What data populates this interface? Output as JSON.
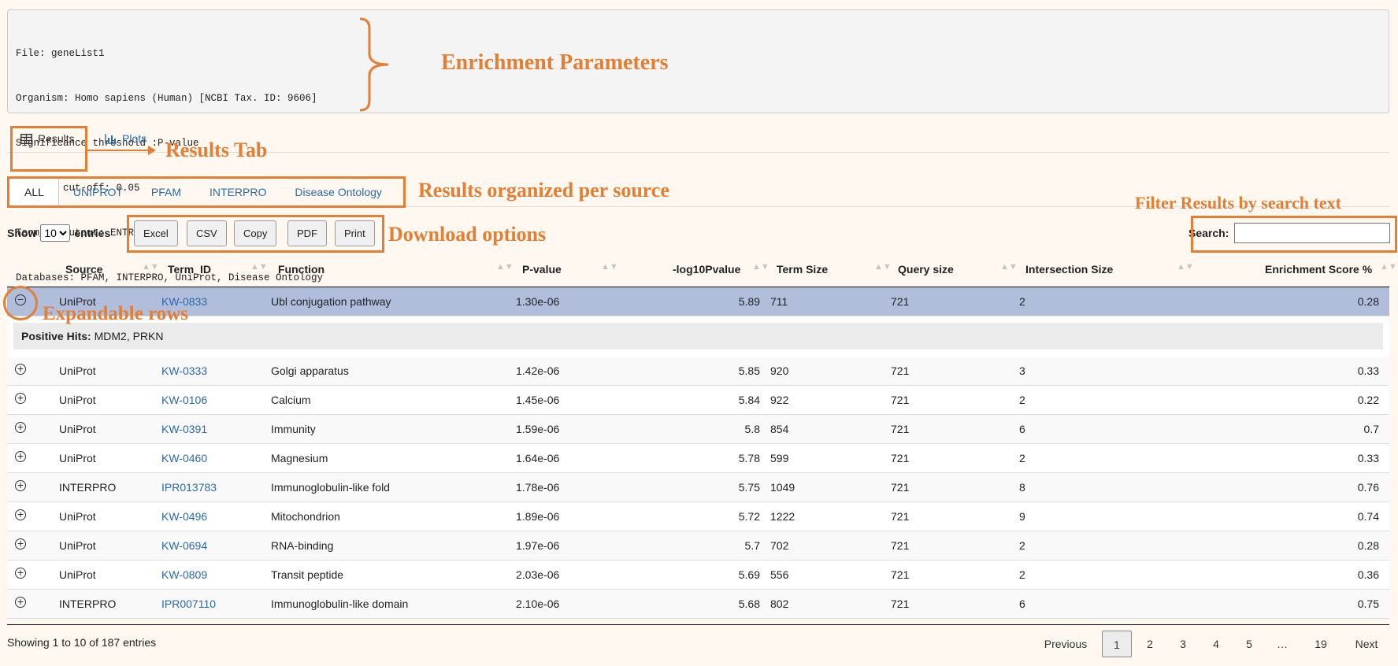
{
  "params": {
    "lines": [
      "File: geneList1",
      "Organism: Homo sapiens (Human) [NCBI Tax. ID: 9606]",
      "Significance threshold :P-value",
      "P-Value cut-off: 0.05",
      "Term_ID output: ENTREZGENE",
      "Databases: PFAM, INTERPRO, UniProt, Disease Ontology"
    ]
  },
  "annotations": {
    "enrichment": "Enrichment Parameters",
    "results_tab": "Results Tab",
    "per_source": "Results organized per source",
    "download": "Download options",
    "filter": "Filter  Results by search text",
    "expandable": "Expandable rows"
  },
  "tabs": {
    "results": "Results",
    "plots": "Plots"
  },
  "sources": [
    "ALL",
    "UNIPROT",
    "PFAM",
    "INTERPRO",
    "Disease Ontology"
  ],
  "controls": {
    "show": "Show",
    "entries_value": "10",
    "entries": "entries",
    "search_label": "Search:",
    "buttons": [
      "Excel",
      "CSV",
      "Copy",
      "PDF",
      "Print"
    ]
  },
  "columns": [
    "Source",
    "Term_ID",
    "Function",
    "P-value",
    "-log10Pvalue",
    "Term Size",
    "Query size",
    "Intersection Size",
    "Enrichment Score %"
  ],
  "rows": [
    {
      "source": "UniProt",
      "term_id": "KW-0833",
      "function": "Ubl conjugation pathway",
      "pvalue": "1.30e-06",
      "log10": "5.89",
      "term_size": "711",
      "query_size": "721",
      "intersection": "2",
      "score": "0.28"
    },
    {
      "source": "UniProt",
      "term_id": "KW-0333",
      "function": "Golgi apparatus",
      "pvalue": "1.42e-06",
      "log10": "5.85",
      "term_size": "920",
      "query_size": "721",
      "intersection": "3",
      "score": "0.33"
    },
    {
      "source": "UniProt",
      "term_id": "KW-0106",
      "function": "Calcium",
      "pvalue": "1.45e-06",
      "log10": "5.84",
      "term_size": "922",
      "query_size": "721",
      "intersection": "2",
      "score": "0.22"
    },
    {
      "source": "UniProt",
      "term_id": "KW-0391",
      "function": "Immunity",
      "pvalue": "1.59e-06",
      "log10": "5.8",
      "term_size": "854",
      "query_size": "721",
      "intersection": "6",
      "score": "0.7"
    },
    {
      "source": "UniProt",
      "term_id": "KW-0460",
      "function": "Magnesium",
      "pvalue": "1.64e-06",
      "log10": "5.78",
      "term_size": "599",
      "query_size": "721",
      "intersection": "2",
      "score": "0.33"
    },
    {
      "source": "INTERPRO",
      "term_id": "IPR013783",
      "function": "Immunoglobulin-like fold",
      "pvalue": "1.78e-06",
      "log10": "5.75",
      "term_size": "1049",
      "query_size": "721",
      "intersection": "8",
      "score": "0.76"
    },
    {
      "source": "UniProt",
      "term_id": "KW-0496",
      "function": "Mitochondrion",
      "pvalue": "1.89e-06",
      "log10": "5.72",
      "term_size": "1222",
      "query_size": "721",
      "intersection": "9",
      "score": "0.74"
    },
    {
      "source": "UniProt",
      "term_id": "KW-0694",
      "function": "RNA-binding",
      "pvalue": "1.97e-06",
      "log10": "5.7",
      "term_size": "702",
      "query_size": "721",
      "intersection": "2",
      "score": "0.28"
    },
    {
      "source": "UniProt",
      "term_id": "KW-0809",
      "function": "Transit peptide",
      "pvalue": "2.03e-06",
      "log10": "5.69",
      "term_size": "556",
      "query_size": "721",
      "intersection": "2",
      "score": "0.36"
    },
    {
      "source": "INTERPRO",
      "term_id": "IPR007110",
      "function": "Immunoglobulin-like domain",
      "pvalue": "2.10e-06",
      "log10": "5.68",
      "term_size": "802",
      "query_size": "721",
      "intersection": "6",
      "score": "0.75"
    }
  ],
  "expanded": {
    "label": "Positive Hits:",
    "value": "MDM2, PRKN"
  },
  "footer": {
    "info": "Showing 1 to 10 of 187 entries",
    "previous": "Previous",
    "pages": [
      "1",
      "2",
      "3",
      "4",
      "5",
      "…",
      "19"
    ],
    "next": "Next"
  },
  "colors": {
    "accent": "#e37e33",
    "link": "#2a6aa8",
    "selected_row": "#b0bedb"
  }
}
